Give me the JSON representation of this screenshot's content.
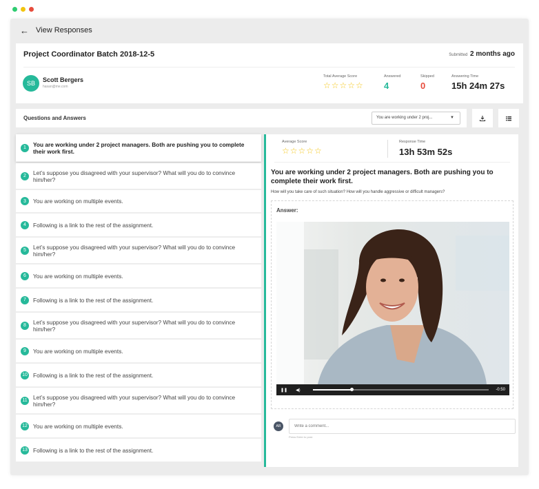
{
  "window": {
    "traffic_lights": [
      "#2ecc71",
      "#f1c40f",
      "#e74c3c"
    ]
  },
  "topbar": {
    "back_icon": "arrow-left-icon",
    "title": "View Responses"
  },
  "header": {
    "project_title": "Project Coordinator Batch 2018-12-5",
    "submitted_label": "Submitted",
    "submitted_value": "2 months ago",
    "user": {
      "initials": "SB",
      "name": "Scott Bergers",
      "email": "hasan@me.com"
    },
    "stats": {
      "avg_score_label": "Total Average Score",
      "avg_score_stars": "☆☆☆☆☆",
      "answered_label": "Answered",
      "answered_value": "4",
      "skipped_label": "Skipped",
      "skipped_value": "0",
      "answering_time_label": "Answering Time",
      "answering_time_value": "15h 24m 27s"
    }
  },
  "qa": {
    "title": "Questions and Answers",
    "select_value": "You are working under 2 proj...",
    "download_icon": "download-icon",
    "list_icon": "list-icon"
  },
  "questions": [
    {
      "num": "1",
      "text": "You are working under 2 project managers. Both are pushing you to complete their work first."
    },
    {
      "num": "2",
      "text": "Let’s suppose you disagreed with your supervisor? What will you do to convince him/her?"
    },
    {
      "num": "3",
      "text": "You are working on multiple events."
    },
    {
      "num": "4",
      "text": "Following is a link to the rest of the assignment."
    },
    {
      "num": "5",
      "text": "Let’s suppose you disagreed with your supervisor? What will you do to convince him/her?"
    },
    {
      "num": "6",
      "text": "You are working on multiple events."
    },
    {
      "num": "7",
      "text": "Following is a link to the rest of the assignment."
    },
    {
      "num": "8",
      "text": "Let’s suppose you disagreed with your supervisor? What will you do to convince him/her?"
    },
    {
      "num": "9",
      "text": "You are working on multiple events."
    },
    {
      "num": "10",
      "text": "Following is a link to the rest of the assignment."
    },
    {
      "num": "11",
      "text": "Let’s suppose you disagreed with your supervisor? What will you do to convince him/her?"
    },
    {
      "num": "12",
      "text": "You are working on multiple events."
    },
    {
      "num": "13",
      "text": "Following is a link to the rest of the assignment."
    }
  ],
  "detail": {
    "avg_score_label": "Average Score",
    "avg_score_stars": "☆☆☆☆☆",
    "response_time_label": "Response Time",
    "response_time_value": "13h 53m 52s",
    "question": "You are working under 2 project managers. Both are pushing you to complete their work first.",
    "subtext": "How will you take care of such situation? How will you handle aggressive or difficult managers?",
    "answer_label": "Answer:",
    "video": {
      "time": "-0:50",
      "progress": 0.22
    },
    "comment": {
      "initials": "AR",
      "placeholder": "Write a comment...",
      "hint": "Press Enter to post."
    }
  },
  "colors": {
    "accent": "#26b99a",
    "star": "#f4c514",
    "skipped": "#e74c3c"
  }
}
